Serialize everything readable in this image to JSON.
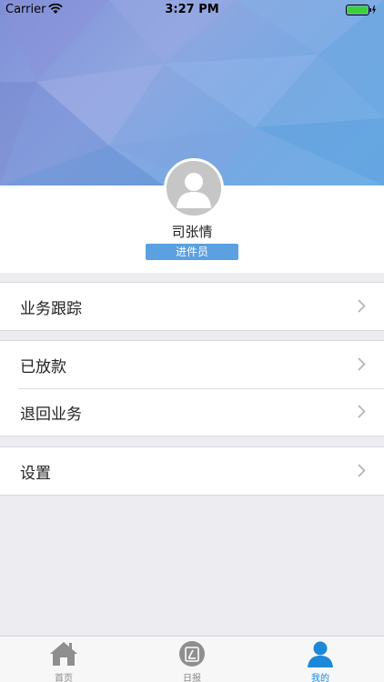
{
  "status_bar": {
    "carrier": "Carrier",
    "time": "3:27 PM"
  },
  "profile": {
    "name": "司张情",
    "role": "进件员"
  },
  "menu": {
    "group1": [
      {
        "label": "业务跟踪"
      }
    ],
    "group2": [
      {
        "label": "已放款"
      },
      {
        "label": "退回业务"
      }
    ],
    "group3": [
      {
        "label": "设置"
      }
    ]
  },
  "tab_bar": {
    "tabs": [
      {
        "label": "首页",
        "icon": "home-icon"
      },
      {
        "label": "日报",
        "icon": "report-icon"
      },
      {
        "label": "我的",
        "icon": "user-icon",
        "active": true
      }
    ]
  },
  "colors": {
    "accent": "#1e88d8",
    "badge": "#5ba0e0",
    "background": "#ececf1"
  }
}
